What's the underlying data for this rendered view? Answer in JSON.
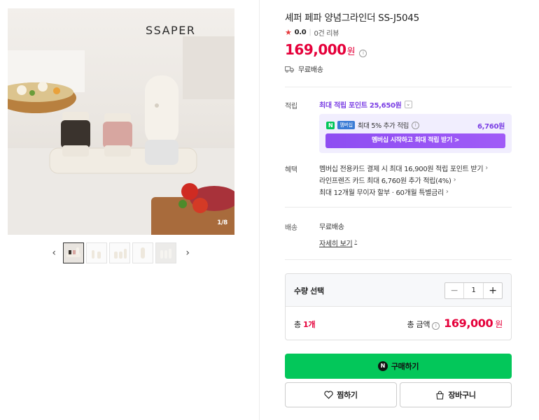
{
  "gallery": {
    "brand": "SSAPER",
    "counter": "1/8",
    "prev_icon": "chevron-left-icon",
    "next_icon": "chevron-right-icon",
    "thumbnail_count": 5
  },
  "product": {
    "title": "셰퍼 페파 양념그라인더 SS-J5045",
    "rating": "0.0",
    "reviews": "0건 리뷰",
    "price": "169,000",
    "price_unit": "원",
    "shipping_short": "무료배송"
  },
  "points": {
    "label": "적립",
    "max_text": "최대 적립 포인트 25,650원",
    "member_badge_n": "N",
    "member_badge_plus": "멤버십",
    "member_text": "최대 5% 추가 적립",
    "member_amount": "6,760원",
    "member_button": "멤버십 시작하고 최대 적립 받기 >"
  },
  "benefits": {
    "label": "혜택",
    "items": [
      "멤버십 전용카드 결제 시 최대 16,900원 적립 포인트 받기",
      "라인프렌즈 카드 최대 6,760원 추가 적립(4%)",
      "최대 12개월 무이자 할부 · 60개월 특별금리"
    ]
  },
  "delivery": {
    "label": "배송",
    "value": "무료배송",
    "link": "자세히 보기"
  },
  "quantity": {
    "title": "수량 선택",
    "value": "1",
    "minus": "−",
    "plus": "+",
    "total_prefix": "총",
    "total_count": "1개",
    "total_label": "총 금액",
    "total_price": "169,000",
    "total_unit": "원"
  },
  "actions": {
    "buy": "구매하기",
    "npay": "N",
    "wish": "찜하기",
    "cart": "장바구니"
  },
  "colors": {
    "accent_red": "#e5003a",
    "naver_green": "#03c75a",
    "member_purple": "#7b3fe4"
  }
}
